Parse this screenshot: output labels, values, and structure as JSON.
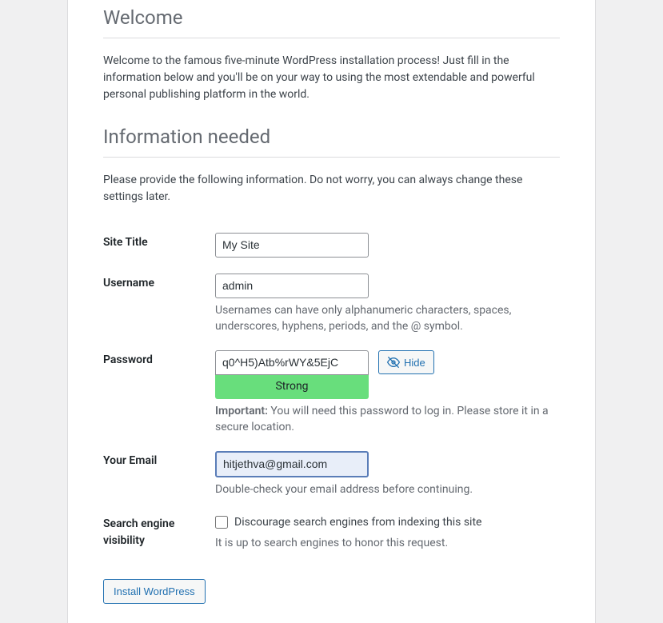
{
  "headings": {
    "welcome": "Welcome",
    "info_needed": "Information needed"
  },
  "intro": {
    "welcome_text": "Welcome to the famous five-minute WordPress installation process! Just fill in the information below and you'll be on your way to using the most extendable and powerful personal publishing platform in the world.",
    "info_text": "Please provide the following information. Do not worry, you can always change these settings later."
  },
  "labels": {
    "site_title": "Site Title",
    "username": "Username",
    "password": "Password",
    "your_email": "Your Email",
    "search_engine": "Search engine visibility"
  },
  "fields": {
    "site_title_value": "My Site",
    "username_value": "admin",
    "password_value": "q0^H5)Atb%rWY&5EjC",
    "email_value": "hitjethva@gmail.com"
  },
  "hints": {
    "username_hint": "Usernames can have only alphanumeric characters, spaces, underscores, hyphens, periods, and the @ symbol.",
    "password_important_label": "Important:",
    "password_important_text": " You will need this password to log in. Please store it in a secure location.",
    "email_hint": "Double-check your email address before continuing.",
    "search_checkbox_label": "Discourage search engines from indexing this site",
    "search_hint": "It is up to search engines to honor this request."
  },
  "password_strength": "Strong",
  "buttons": {
    "hide": "Hide",
    "install": "Install WordPress"
  }
}
